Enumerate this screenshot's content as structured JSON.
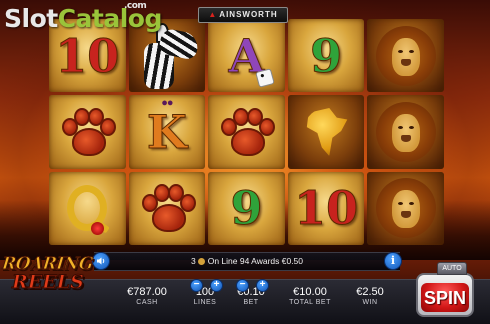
{
  "watermark": {
    "part1": "Slot",
    "part2": "Catalog",
    "suffix": ".com"
  },
  "brand": {
    "name": "AINSWORTH"
  },
  "game_logo": {
    "line1": "ROARING",
    "line2": "REELS"
  },
  "reels": [
    [
      {
        "symbol": "10",
        "kind": "letter",
        "color": "red",
        "icon": "ten-symbol-icon"
      },
      {
        "symbol": "paw",
        "kind": "paw",
        "icon": "paw-print-icon"
      },
      {
        "symbol": "Q",
        "kind": "q",
        "icon": "queen-symbol-icon"
      }
    ],
    [
      {
        "symbol": "zebra",
        "kind": "zebra",
        "icon": "zebra-icon"
      },
      {
        "symbol": "K",
        "kind": "letter",
        "color": "orange",
        "icon": "king-symbol-icon"
      },
      {
        "symbol": "paw",
        "kind": "paw",
        "icon": "paw-print-icon"
      }
    ],
    [
      {
        "symbol": "A",
        "kind": "letter",
        "color": "purple",
        "icon": "ace-symbol-icon"
      },
      {
        "symbol": "paw",
        "kind": "paw",
        "icon": "paw-print-icon"
      },
      {
        "symbol": "9",
        "kind": "letter",
        "color": "green",
        "icon": "nine-symbol-icon"
      }
    ],
    [
      {
        "symbol": "9",
        "kind": "letter",
        "color": "green",
        "icon": "nine-symbol-icon"
      },
      {
        "symbol": "africa",
        "kind": "africa",
        "icon": "africa-map-icon"
      },
      {
        "symbol": "10",
        "kind": "letter",
        "color": "red",
        "icon": "ten-symbol-icon"
      }
    ],
    [
      {
        "symbol": "lion",
        "kind": "lion",
        "icon": "lion-icon"
      },
      {
        "symbol": "lion",
        "kind": "lion",
        "icon": "lion-icon"
      },
      {
        "symbol": "lion",
        "kind": "lion",
        "icon": "lion-icon"
      }
    ]
  ],
  "message": {
    "count": "3",
    "text": "On Line 94 Awards €0.50"
  },
  "stats": {
    "cash": {
      "value": "€787.00",
      "label": "CASH"
    },
    "lines": {
      "value": "100",
      "label": "LINES"
    },
    "bet": {
      "value": "€0.10",
      "label": "BET"
    },
    "total_bet": {
      "value": "€10.00",
      "label": "TOTAL BET"
    },
    "win": {
      "value": "€2.50",
      "label": "WIN"
    }
  },
  "buttons": {
    "spin": "SPIN",
    "auto": "AUTO",
    "info": "i",
    "minus": "−",
    "plus": "+"
  },
  "colors": {
    "red": "#c8231e",
    "green": "#2fa33a",
    "purple": "#8f46b8",
    "orange": "#e07b1e",
    "spin": "#d21616",
    "control_blue": "#1e6fd9"
  }
}
